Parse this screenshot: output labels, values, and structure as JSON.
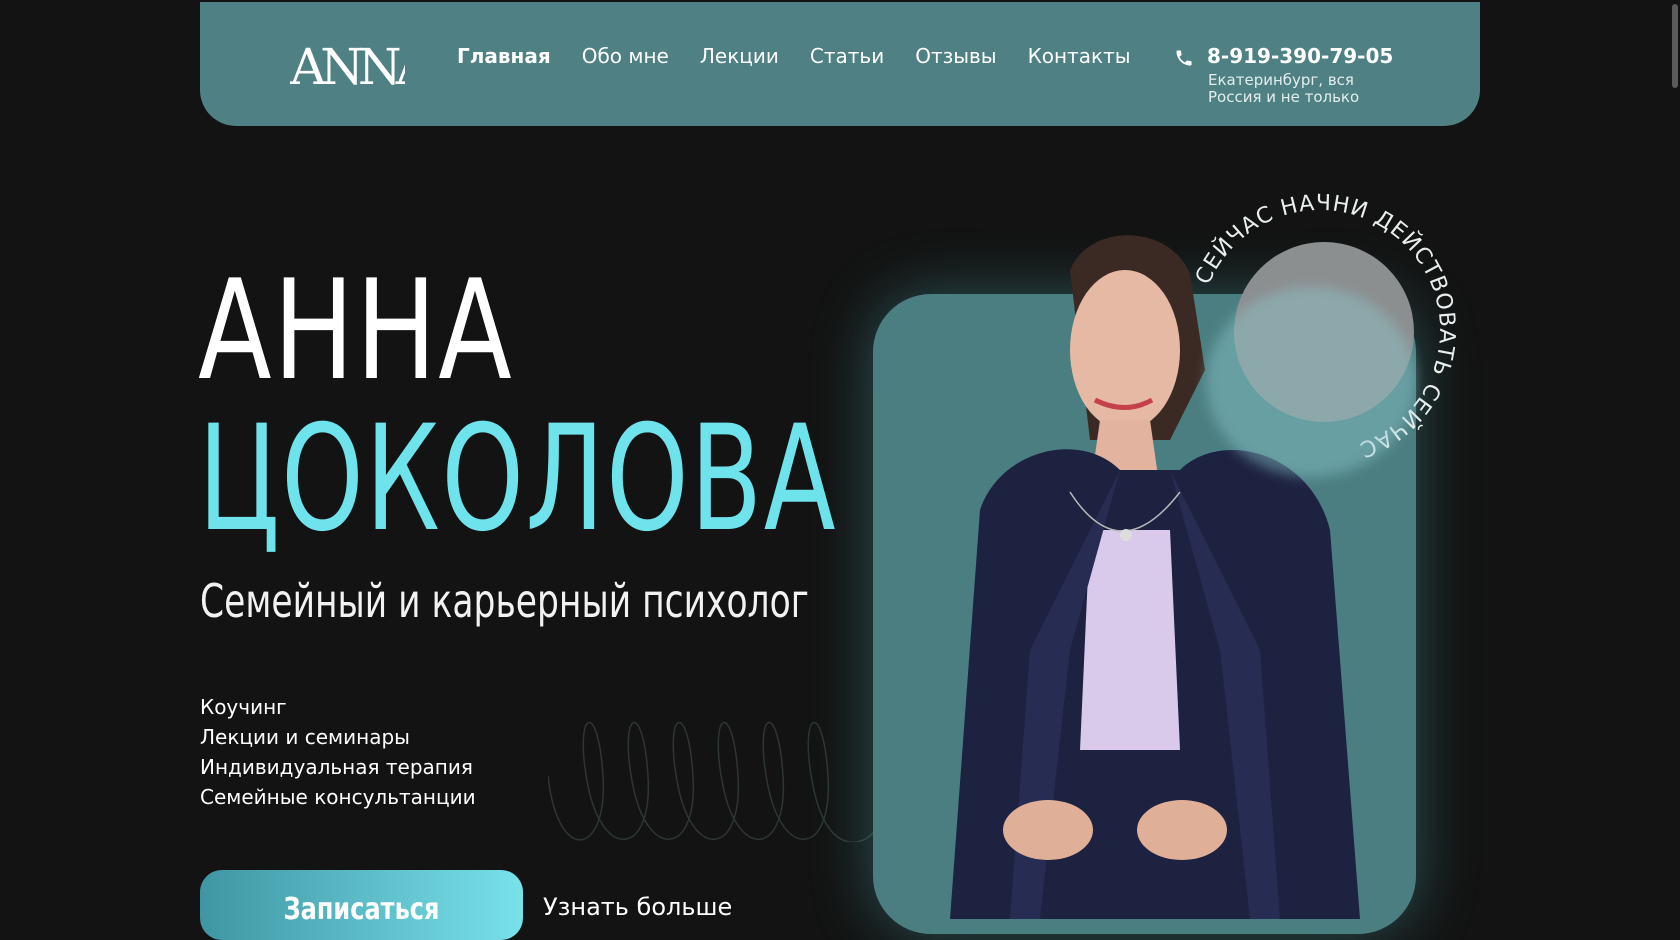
{
  "header": {
    "logo_text": "ANNA",
    "nav": [
      "Главная",
      "Обо мне",
      "Лекции",
      "Статьи",
      "Отзывы",
      "Контакты"
    ],
    "active_nav": "Главная",
    "phone": "8-919-390-79-05",
    "location": "Екатеринбург, вся Россия и не только"
  },
  "hero": {
    "first_name": "АННА",
    "last_name": "ЦОКОЛОВА",
    "subtitle": "Семейный и карьерный психолог",
    "services": [
      "Коучинг",
      "Лекции и семинары",
      "Индивидуальная терапия",
      "Семейные консультанции"
    ],
    "cta_label": "Записаться",
    "more_label": "Узнать больше",
    "ring_text": "СЕЙЧАС НАЧНИ ДЕЙСТВОВАТЬ СЕЙЧАС"
  },
  "colors": {
    "background": "#131313",
    "header": "#4f8083",
    "accent": "#6fe3ec",
    "photo_card": "#4b7e81"
  },
  "icons": [
    "phone-icon",
    "decorative-loops"
  ]
}
